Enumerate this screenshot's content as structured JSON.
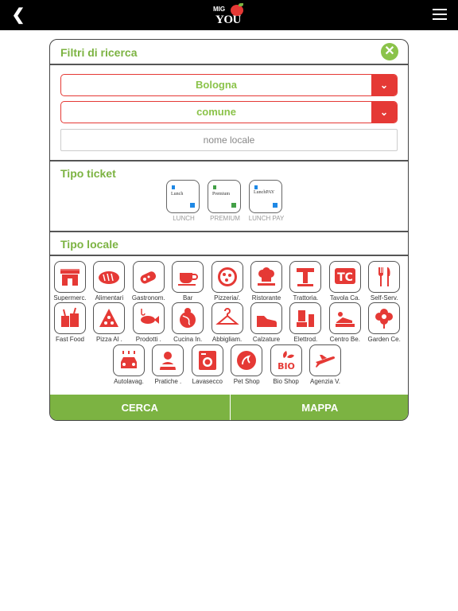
{
  "header": {
    "logo": {
      "top": "MIG",
      "bottom": "YOU"
    }
  },
  "filters": {
    "title": "Filtri di ricerca",
    "province": "Bologna",
    "comune": "comune",
    "nome_placeholder": "nome locale"
  },
  "tipo_ticket": {
    "title": "Tipo ticket",
    "items": [
      {
        "card": "Lunch",
        "label": "LUNCH"
      },
      {
        "card": "Premium",
        "label": "PREMIUM"
      },
      {
        "card": "LunchPAY",
        "label": "LUNCH PAY"
      }
    ]
  },
  "tipo_locale": {
    "title": "Tipo locale",
    "items": [
      {
        "label": "Supermerc.",
        "icon": "shop-icon"
      },
      {
        "label": "Alimentari",
        "icon": "bread-icon"
      },
      {
        "label": "Gastronom.",
        "icon": "salami-icon"
      },
      {
        "label": "Bar",
        "icon": "coffee-cup-icon"
      },
      {
        "label": "Pizzeria/.",
        "icon": "pizza-icon"
      },
      {
        "label": "Ristorante",
        "icon": "chef-hat-icon"
      },
      {
        "label": "Trattoria.",
        "icon": "trattoria-t-icon"
      },
      {
        "label": "Tavola Ca.",
        "icon": "tavola-calda-icon"
      },
      {
        "label": "Self-Serv.",
        "icon": "fork-knife-icon"
      },
      {
        "label": "Fast Food",
        "icon": "fast-food-icon"
      },
      {
        "label": "Pizza Al .",
        "icon": "pizza-slice-icon"
      },
      {
        "label": "Prodotti .",
        "icon": "fish-icon"
      },
      {
        "label": "Cucina In.",
        "icon": "globe-chef-icon"
      },
      {
        "label": "Abbigliam.",
        "icon": "hanger-icon"
      },
      {
        "label": "Calzature",
        "icon": "shoe-icon"
      },
      {
        "label": "Elettrod.",
        "icon": "blender-icon"
      },
      {
        "label": "Centro Be.",
        "icon": "spa-icon"
      },
      {
        "label": "Garden Ce.",
        "icon": "flower-icon"
      },
      {
        "label": "Autolavag.",
        "icon": "car-wash-icon"
      },
      {
        "label": "Pratiche .",
        "icon": "clerk-icon"
      },
      {
        "label": "Lavasecco",
        "icon": "washing-machine-icon"
      },
      {
        "label": "Pet Shop",
        "icon": "pet-icon"
      },
      {
        "label": "Bio Shop",
        "icon": "bio-leaf-icon"
      },
      {
        "label": "Agenzia V.",
        "icon": "airplane-icon"
      }
    ]
  },
  "buttons": {
    "cerca": "CERCA",
    "mappa": "MAPPA"
  },
  "colors": {
    "accent_red": "#e53935",
    "accent_green": "#7cb342",
    "topbar": "#000000"
  }
}
